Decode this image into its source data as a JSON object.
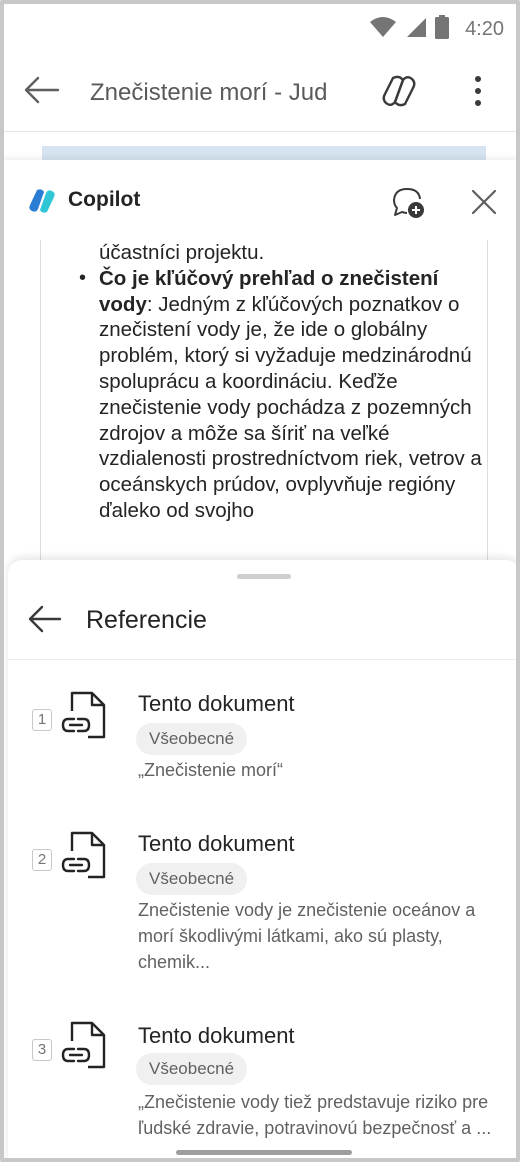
{
  "status_bar": {
    "time": "4:20"
  },
  "app_bar": {
    "title": "Znečistenie morí - Jud",
    "icons": [
      "back-arrow-icon",
      "copilot-icon",
      "more-vertical-icon"
    ]
  },
  "copilot": {
    "title": "Copilot",
    "cut_line": "účastníci projektu.",
    "bullet_heading": "Čo je kľúčový prehľad o znečistení vody",
    "bullet_body": ": Jedným z kľúčových poznatkov o znečistení vody je, že ide o globálny problém, ktorý si vyžaduje medzinárodnú spoluprácu a koordináciu. Keďže znečistenie vody pochádza z pozemných zdrojov a môže sa šíriť na veľké vzdialenosti prostredníctvom riek, vetrov a oceánskych prúdov, ovplyvňuje regióny ďaleko od svojho",
    "colors": {
      "logo_blue": "#2b7cd3",
      "logo_teal": "#31c6d6"
    }
  },
  "references": {
    "title": "Referencie",
    "items": [
      {
        "number": "1",
        "name": "Tento dokument",
        "badge": "Všeobecné",
        "desc": "„Znečistenie morí“"
      },
      {
        "number": "2",
        "name": "Tento dokument",
        "badge": "Všeobecné",
        "desc": "Znečistenie vody je znečistenie oceánov a morí škodlivými látkami, ako sú plasty, chemik..."
      },
      {
        "number": "3",
        "name": "Tento dokument",
        "badge": "Všeobecné",
        "desc": "„Znečistenie vody tiež predstavuje riziko pre ľudské zdravie, potravinovú bezpečnosť a ..."
      }
    ]
  }
}
